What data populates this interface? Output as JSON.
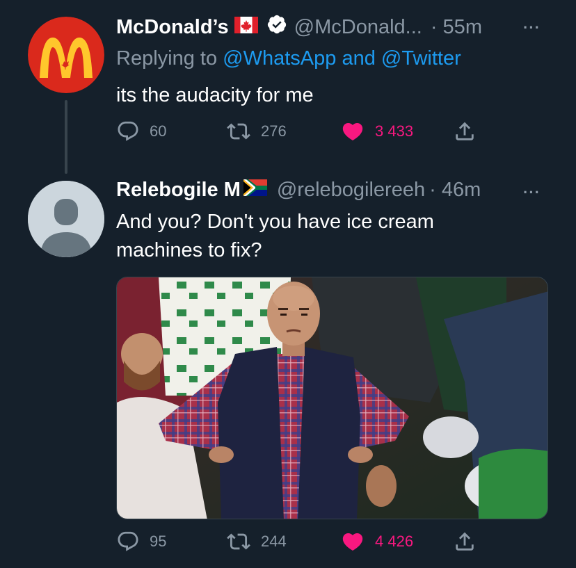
{
  "tweet1": {
    "name": "McDonald’s",
    "handle": "@McDonald...",
    "time": "· 55m",
    "more": "···",
    "replying_prefix": "Replying to ",
    "mention1": "@WhatsApp",
    "and_word": " and ",
    "mention2": "@Twitter",
    "text": "its the audacity for me",
    "replies": "60",
    "retweets": "276",
    "likes": "3 433"
  },
  "tweet2": {
    "name": "Relebogile M",
    "handle": "@relebogilereeh",
    "time": "· 46m",
    "more": "···",
    "text_line1": "And you? Don't you have ice cream",
    "text_line2": "machines to fix?",
    "replies": "95",
    "retweets": "244",
    "likes": "4 426"
  },
  "colors": {
    "background": "#15202b",
    "secondary_text": "#8b98a5",
    "mention": "#1d9bf0",
    "like": "#f91880",
    "mcdonalds_red": "#da291c",
    "mcdonalds_yellow": "#ffc72c"
  },
  "icons": [
    "reply-icon",
    "retweet-icon",
    "like-icon",
    "share-icon",
    "verified-icon",
    "canada-flag-icon",
    "south-africa-flag-icon",
    "more-icon"
  ]
}
